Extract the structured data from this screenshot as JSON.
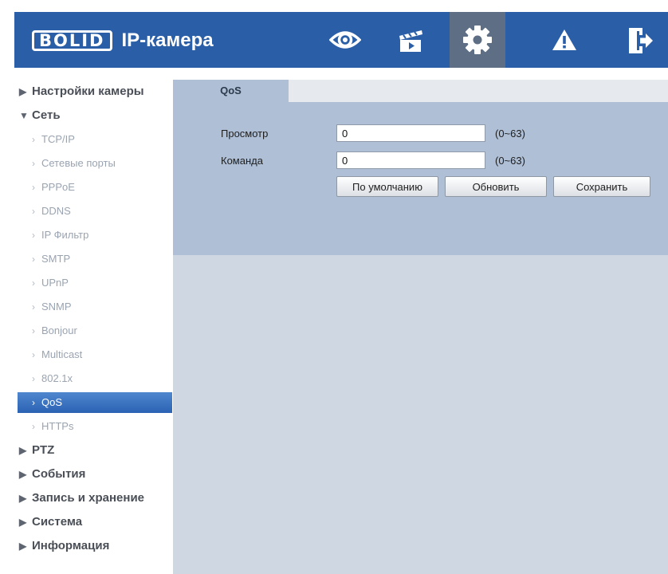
{
  "header": {
    "brand": "BOLID",
    "product": "IP-камера",
    "nav_icons": [
      "eye-icon",
      "clapperboard-icon",
      "gear-icon",
      "warning-icon",
      "logout-icon"
    ],
    "active_icon": "gear-icon",
    "colors": {
      "bar": "#2a5fa8",
      "active": "#5d6e85"
    }
  },
  "sidebar": {
    "camera_settings": "Настройки камеры",
    "network": "Сеть",
    "network_items": [
      "TCP/IP",
      "Сетевые порты",
      "PPPoE",
      "DDNS",
      "IP Фильтр",
      "SMTP",
      "UPnP",
      "SNMP",
      "Bonjour",
      "Multicast",
      "802.1x",
      "QoS",
      "HTTPs"
    ],
    "active_item": "QoS",
    "ptz": "PTZ",
    "events": "События",
    "storage": "Запись и хранение",
    "system": "Система",
    "info": "Информация"
  },
  "content": {
    "tab": "QoS",
    "fields": {
      "view_label": "Просмотр",
      "view_value": "0",
      "view_range": "(0~63)",
      "command_label": "Команда",
      "command_value": "0",
      "command_range": "(0~63)"
    },
    "buttons": {
      "default": "По умолчанию",
      "refresh": "Обновить",
      "save": "Сохранить"
    }
  }
}
